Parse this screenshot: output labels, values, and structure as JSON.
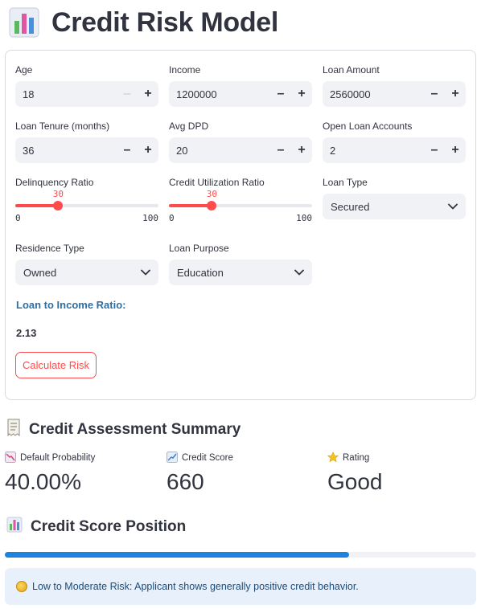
{
  "header": {
    "title": "Credit Risk Model",
    "icon": "bar-chart-icon"
  },
  "form": {
    "age": {
      "label": "Age",
      "value": "18",
      "minus": "–",
      "plus": "+"
    },
    "income": {
      "label": "Income",
      "value": "1200000",
      "minus": "–",
      "plus": "+"
    },
    "loan_amount": {
      "label": "Loan Amount",
      "value": "2560000",
      "minus": "–",
      "plus": "+"
    },
    "loan_tenure": {
      "label": "Loan Tenure (months)",
      "value": "36",
      "minus": "–",
      "plus": "+"
    },
    "avg_dpd": {
      "label": "Avg DPD",
      "value": "20",
      "minus": "–",
      "plus": "+"
    },
    "open_loan_accounts": {
      "label": "Open Loan Accounts",
      "value": "2",
      "minus": "–",
      "plus": "+"
    },
    "delinquency_ratio": {
      "label": "Delinquency Ratio",
      "value": 30,
      "value_text": "30",
      "min": "0",
      "max": "100"
    },
    "credit_utilization_ratio": {
      "label": "Credit Utilization Ratio",
      "value": 30,
      "value_text": "30",
      "min": "0",
      "max": "100"
    },
    "loan_type": {
      "label": "Loan Type",
      "selected": "Secured"
    },
    "residence_type": {
      "label": "Residence Type",
      "selected": "Owned"
    },
    "loan_purpose": {
      "label": "Loan Purpose",
      "selected": "Education"
    },
    "loan_to_income": {
      "label": "Loan to Income Ratio:",
      "value": "2.13"
    },
    "calculate_label": "Calculate Risk"
  },
  "summary": {
    "heading": "Credit Assessment Summary",
    "metrics": [
      {
        "label": "Default Probability",
        "value": "40.00%",
        "icon": "chart-decreasing-icon"
      },
      {
        "label": "Credit Score",
        "value": "660",
        "icon": "chart-increasing-icon"
      },
      {
        "label": "Rating",
        "value": "Good",
        "icon": "star-icon"
      }
    ]
  },
  "position": {
    "heading": "Credit Score Position",
    "progress": 0.73
  },
  "alert": {
    "text": "Low to Moderate Risk: Applicant shows generally positive credit behavior."
  },
  "colors": {
    "accent": "#ff4b4b",
    "progress": "#1c83e1",
    "info_bg": "#e7f0fb",
    "info_text": "#1a4d7c"
  }
}
